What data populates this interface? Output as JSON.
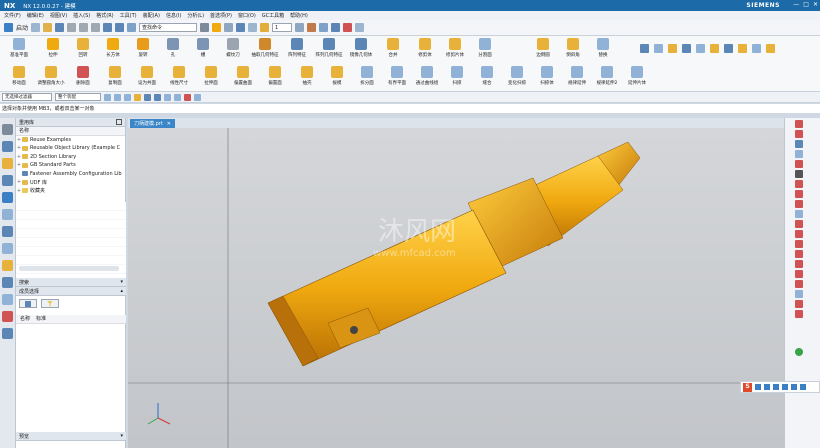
{
  "titlebar": {
    "logo": "NX",
    "title": "NX 12.0.0.27 - 建模",
    "brand": "SIEMENS",
    "minimize": "—",
    "maximize": "□",
    "close": "✕"
  },
  "menubar": [
    "文件(F)",
    "编辑(E)",
    "视图(V)",
    "插入(S)",
    "格式(R)",
    "工具(T)",
    "装配(A)",
    "信息(I)",
    "分析(L)",
    "首选项(P)",
    "窗口(O)",
    "GC工具箱",
    "帮助(H)"
  ],
  "quickbar": {
    "start_label": "启动",
    "command_search_placeholder": "查找命令",
    "layer_value": "1"
  },
  "ribbon": {
    "row1": [
      "基准平面",
      "拉伸",
      "回转",
      "长方体",
      "旋转",
      "孔",
      "槽",
      "螺纹刀",
      "抽取几何特征",
      "阵列特征",
      "阵列几何特征",
      "镜像几何体",
      "合并",
      "修剪体",
      "修剪片体",
      "分割面",
      "边倒圆",
      "倒斜角",
      "替换"
    ],
    "row2": [
      "移动面",
      "调整圆角大小",
      "删除面",
      "复制面",
      "设为共面",
      "线性尺寸",
      "拉伸面",
      "偏置曲面",
      "偏置面",
      "抽壳",
      "拔模",
      "拆分面",
      "有界平面",
      "通过曲线组",
      "扫掠",
      "缝合",
      "变化扫掠",
      "扫掠体",
      "规律延伸",
      "规律延伸2",
      "延伸片体"
    ]
  },
  "filterbar": {
    "filter_value": "无选择过滤器",
    "assembly_value": "整个装配"
  },
  "cue": "选择对象并使用 MB3，或者双击某一对象",
  "navpanel": {
    "title": "重用库",
    "header": "名称",
    "items": [
      "Reuse Examples",
      "Reusable Object Library (Example C",
      "2D Section Library",
      "GB Standard Parts",
      "Fastener Assembly Configuration Lib",
      "UDF 库",
      "收藏夹"
    ],
    "search_label": "搜索",
    "member_label": "成员选择",
    "col_name": "名称",
    "col_label": "标准",
    "preview_label": "预览"
  },
  "viewport": {
    "tab_label": "刀柄建模.prt",
    "watermark": "沐风网",
    "watermark_url": "www.mfcad.com"
  },
  "colors": {
    "accent": "#1c6aa8",
    "model": "#f0a90f",
    "model_dark": "#c97d07"
  }
}
